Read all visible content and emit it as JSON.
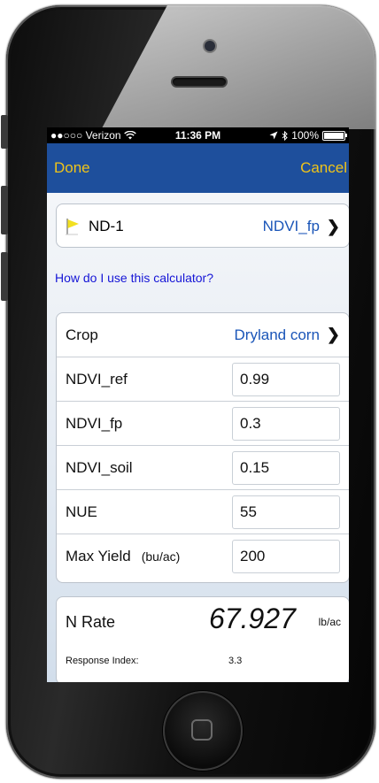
{
  "status_bar": {
    "carrier": "●●○○○ Verizon",
    "time": "11:36 PM",
    "battery": "100%"
  },
  "nav": {
    "done_label": "Done",
    "cancel_label": "Cancel"
  },
  "field_selector": {
    "name": "ND-1",
    "type": "NDVI_fp"
  },
  "help_link": "How do I use this calculator?",
  "inputs": {
    "crop_label": "Crop",
    "crop_value": "Dryland corn",
    "ndvi_ref_label": "NDVI_ref",
    "ndvi_ref_value": "0.99",
    "ndvi_fp_label": "NDVI_fp",
    "ndvi_fp_value": "0.3",
    "ndvi_soil_label": "NDVI_soil",
    "ndvi_soil_value": "0.15",
    "nue_label": "NUE",
    "nue_value": "55",
    "max_yield_label": "Max Yield",
    "max_yield_unit": "(bu/ac)",
    "max_yield_value": "200"
  },
  "result": {
    "n_rate_label": "N Rate",
    "n_rate_value": "67.927",
    "n_rate_unit": "lb/ac",
    "response_index_label": "Response Index:",
    "response_index_value": "3.3"
  },
  "colors": {
    "nav_background": "#1e4f9c",
    "nav_text": "#f0c419",
    "link_blue": "#1a55b8",
    "flag_yellow": "#f2e021"
  }
}
